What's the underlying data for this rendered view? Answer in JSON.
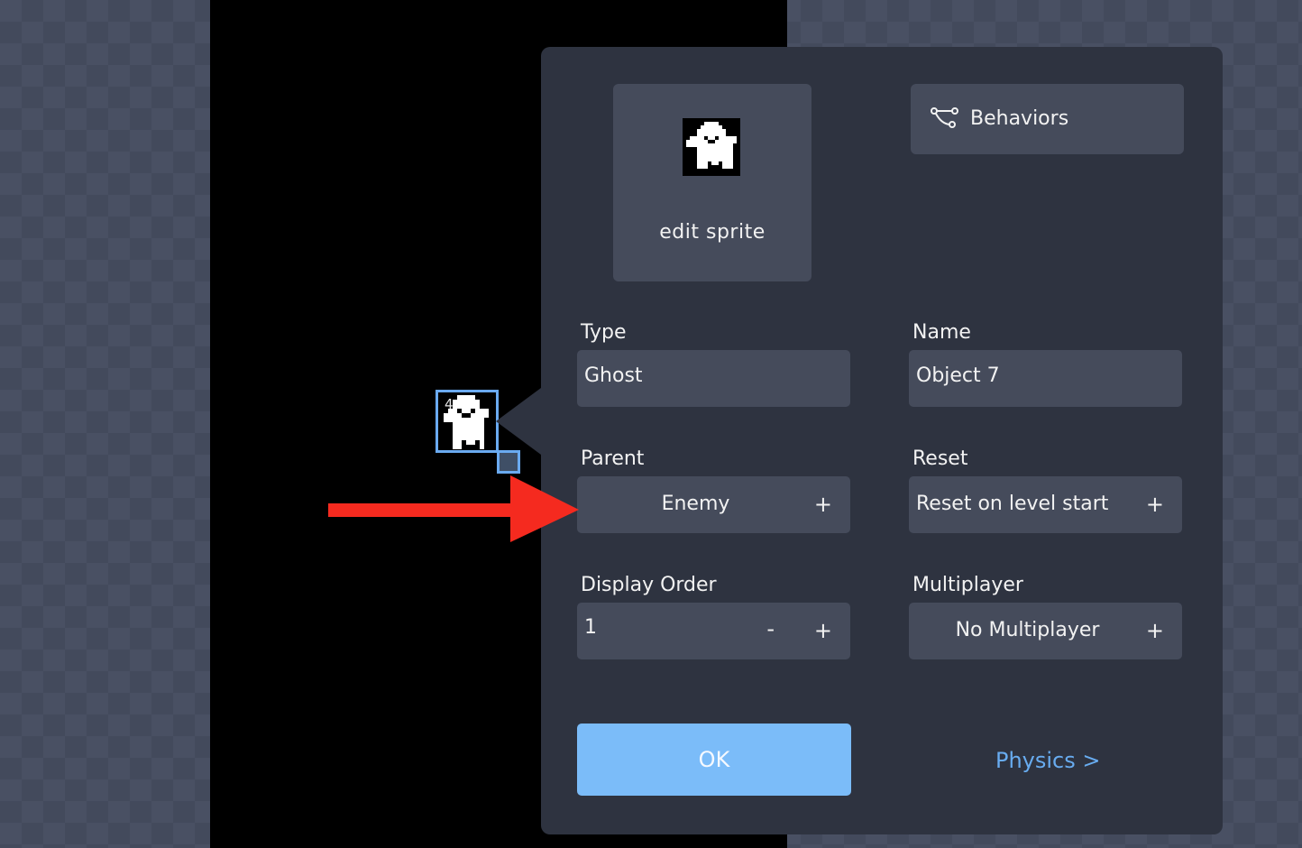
{
  "scene": {
    "object_id_label": "4"
  },
  "panel": {
    "sprite_button_label": "edit sprite",
    "behaviors_button_label": "Behaviors",
    "type": {
      "label": "Type",
      "value": "Ghost"
    },
    "name": {
      "label": "Name",
      "value": "Object 7"
    },
    "parent": {
      "label": "Parent",
      "value": "Enemy",
      "add": "+"
    },
    "reset": {
      "label": "Reset",
      "value": "Reset on level start",
      "add": "+"
    },
    "display_order": {
      "label": "Display Order",
      "value": "1",
      "decrement": "-",
      "increment": "+"
    },
    "multiplayer": {
      "label": "Multiplayer",
      "value": "No Multiplayer",
      "add": "+"
    },
    "ok_label": "OK",
    "physics_label": "Physics >"
  },
  "icons": {
    "sprite": "ghost-sprite-icon",
    "behaviors": "behavior-graph-icon",
    "annotation": "red-arrow-icon"
  },
  "colors": {
    "panel_bg": "#2e3340",
    "field_bg": "#454b5b",
    "ok_button": "#7bbcf9",
    "link": "#68acf0",
    "selection": "#6aaaf0",
    "annotation_arrow": "#f52a1f"
  }
}
